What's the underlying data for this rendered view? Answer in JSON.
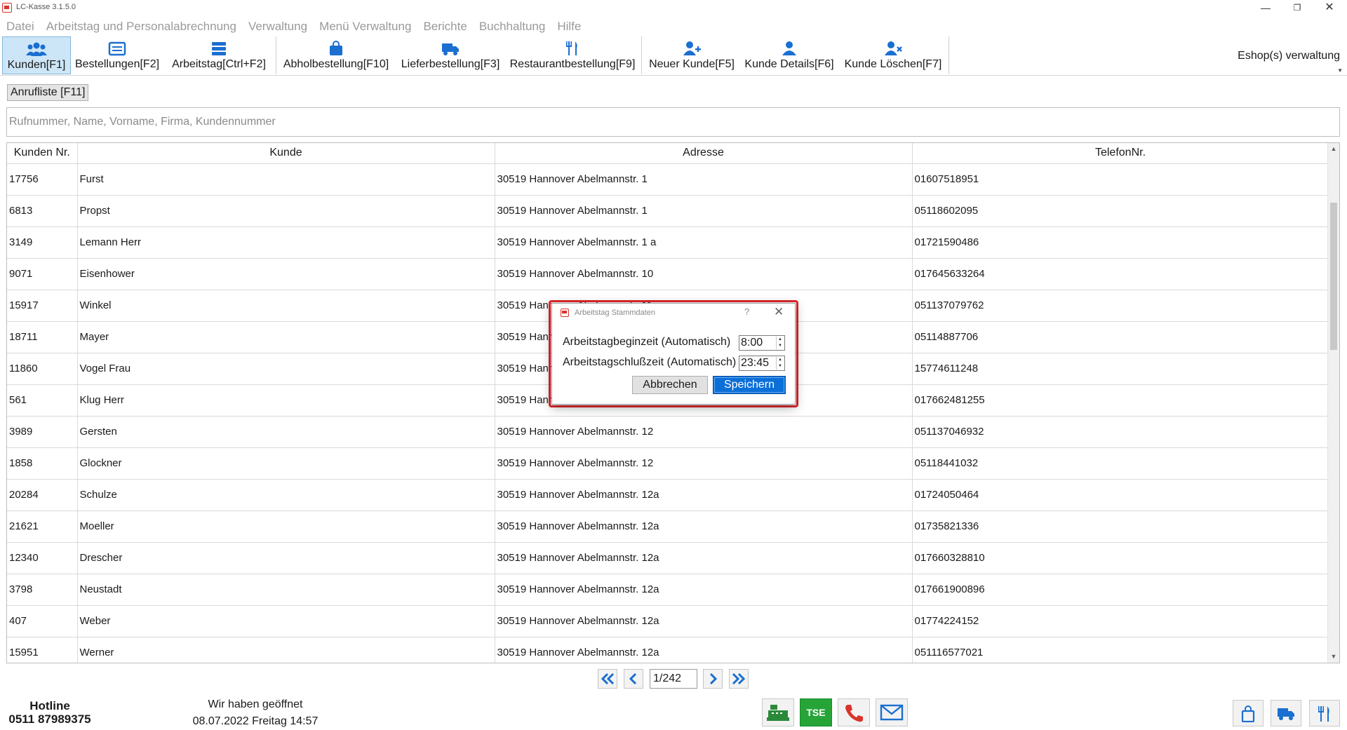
{
  "window": {
    "title": "LC-Kasse 3.1.5.0"
  },
  "menu": [
    "Datei",
    "Arbeitstag und Personalabrechnung",
    "Verwaltung",
    "Menü Verwaltung",
    "Berichte",
    "Buchhaltung",
    "Hilfe"
  ],
  "toolbar": {
    "kunden": "Kunden[F1]",
    "bestellungen": "Bestellungen[F2]",
    "arbeitstag": "Arbeitstag[Ctrl+F2]",
    "abholbestellung": "Abholbestellung[F10]",
    "lieferbestellung": "Lieferbestellung[F3]",
    "restaurantbestellung": "Restaurantbestellung[F9]",
    "neuer_kunde": "Neuer Kunde[F5]",
    "kunde_details": "Kunde Details[F6]",
    "kunde_loeschen": "Kunde Löschen[F7]",
    "eshop": "Eshop(s) verwaltung",
    "accent": "#1a6fd0"
  },
  "anrufliste": "Anrufliste [F11]",
  "search": {
    "placeholder": "Rufnummer, Name, Vorname, Firma, Kundennummer",
    "value": ""
  },
  "table": {
    "headers": [
      "Kunden Nr.",
      "Kunde",
      "Adresse",
      "TelefonNr."
    ],
    "rows": [
      [
        "17756",
        "Furst",
        "30519 Hannover Abelmannstr. 1",
        "01607518951"
      ],
      [
        "6813",
        "Propst",
        "30519 Hannover Abelmannstr. 1",
        "05118602095"
      ],
      [
        "3149",
        "Lemann Herr",
        "30519 Hannover Abelmannstr. 1 a",
        "01721590486"
      ],
      [
        "9071",
        "Eisenhower",
        "30519 Hannover Abelmannstr. 10",
        "017645633264"
      ],
      [
        "15917",
        "Winkel",
        "30519 Hannover Abelmannstr. 11",
        "051137079762"
      ],
      [
        "18711",
        "Mayer",
        "30519 Hannover Abelmannstr. 11",
        "05114887706"
      ],
      [
        "11860",
        "Vogel Frau",
        "30519 Hannover Abelmannstr. 11",
        "15774611248"
      ],
      [
        "561",
        "Klug Herr",
        "30519 Hannover Abelmannstr. 12",
        "017662481255"
      ],
      [
        "3989",
        "Gersten",
        "30519 Hannover Abelmannstr. 12",
        "051137046932"
      ],
      [
        "1858",
        "Glockner",
        "30519 Hannover Abelmannstr. 12",
        "05118441032"
      ],
      [
        "20284",
        "Schulze",
        "30519 Hannover Abelmannstr. 12a",
        "01724050464"
      ],
      [
        "21621",
        "Moeller",
        "30519 Hannover Abelmannstr. 12a",
        "01735821336"
      ],
      [
        "12340",
        "Drescher",
        "30519 Hannover Abelmannstr. 12a",
        "017660328810"
      ],
      [
        "3798",
        "Neustadt",
        "30519 Hannover Abelmannstr. 12a",
        "017661900896"
      ],
      [
        "407",
        "Weber",
        "30519 Hannover Abelmannstr. 12a",
        "01774224152"
      ],
      [
        "15951",
        "Werner",
        "30519 Hannover Abelmannstr. 12a",
        "051116577021"
      ]
    ]
  },
  "pager": {
    "page": "1/242"
  },
  "footer": {
    "hotline_label": "Hotline",
    "hotline_number": "0511 87989375",
    "open_status": "Wir haben geöffnet",
    "datetime": "08.07.2022 Freitag 14:57",
    "tse": "TSE"
  },
  "dialog": {
    "title": "Arbeitstag Stammdaten",
    "help": "?",
    "start_label": "Arbeitstagbeginzeit (Automatisch)",
    "start_value": "8:00",
    "end_label": "Arbeitstagschlußzeit (Automatisch)",
    "end_value": "23:45",
    "cancel": "Abbrechen",
    "save": "Speichern"
  }
}
